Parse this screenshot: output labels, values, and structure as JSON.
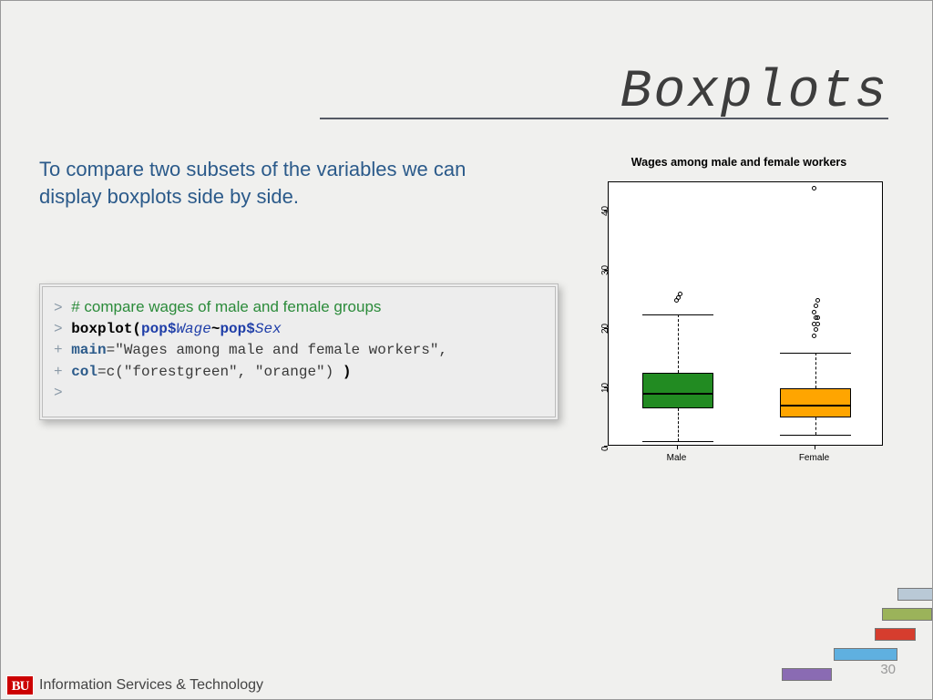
{
  "title": "Boxplots",
  "intro": "To compare two subsets of the variables we can display boxplots side by side.",
  "code": {
    "comment": "# compare wages of male and female groups",
    "l1_fn": "boxplot(",
    "l1_var1": "pop",
    "l1_wage": "Wage",
    "l1_tilde": "~",
    "l1_var2": "pop",
    "l1_sex": "Sex",
    "l2_arg": "main",
    "l2_str": "=\"Wages among male and female workers\",",
    "l3_arg": "col",
    "l3_str": "=c(\"forestgreen\", \"orange\") ",
    "l3_close": ")"
  },
  "chart_data": {
    "type": "boxplot",
    "title": "Wages among male and female workers",
    "ylabel": "",
    "ylim": [
      0,
      45
    ],
    "yticks": [
      0,
      10,
      20,
      30,
      40
    ],
    "categories": [
      "Male",
      "Female"
    ],
    "series": [
      {
        "name": "Male",
        "color": "#228b22",
        "min": 1,
        "q1": 6.5,
        "median": 9.0,
        "q3": 12.5,
        "max": 22.5,
        "outliers": [
          25,
          25.5,
          26
        ]
      },
      {
        "name": "Female",
        "color": "#ffa500",
        "min": 2,
        "q1": 5.0,
        "median": 7.0,
        "q3": 10.0,
        "max": 16.0,
        "outliers": [
          19,
          20,
          21,
          21,
          22,
          22,
          23,
          24,
          25,
          44
        ]
      }
    ]
  },
  "footer": {
    "badge": "BU",
    "org": "Information Services & Technology",
    "page": "30"
  },
  "deco_colors": [
    "#b9c9d6",
    "#9bb35a",
    "#d63d2e",
    "#5fb0e0",
    "#8a6bb3"
  ]
}
